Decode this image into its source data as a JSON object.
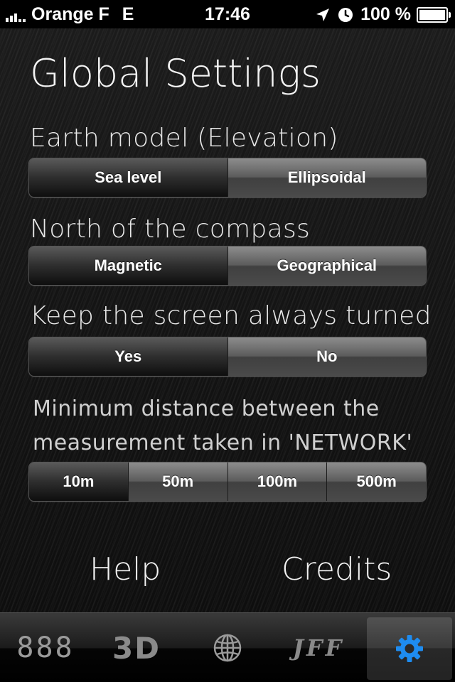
{
  "status_bar": {
    "carrier": "Orange F",
    "network": "E",
    "time": "17:46",
    "battery": "100 %",
    "icons": [
      "signal-bars-icon",
      "location-arrow-icon",
      "alarm-clock-icon",
      "battery-icon"
    ]
  },
  "page": {
    "title": "Global Settings"
  },
  "settings": {
    "earth_model": {
      "label": "Earth model (Elevation)",
      "options": [
        "Sea level",
        "Ellipsoidal"
      ],
      "selected": "Sea level"
    },
    "compass_north": {
      "label": "North of the compass",
      "options": [
        "Magnetic",
        "Geographical"
      ],
      "selected": "Magnetic"
    },
    "keep_screen_on": {
      "label": "Keep the screen always turned on",
      "options": [
        "Yes",
        "No"
      ],
      "selected": "Yes"
    },
    "min_distance": {
      "label_line1": "Minimum distance between the",
      "label_line2": "measurement taken in 'NETWORK'",
      "options": [
        "10m",
        "50m",
        "100m",
        "500m"
      ],
      "selected": "10m"
    }
  },
  "links": {
    "help": "Help",
    "credits": "Credits"
  },
  "tab_bar": {
    "tabs": [
      {
        "name": "digits",
        "label": "888",
        "icon": "digital-display-icon"
      },
      {
        "name": "3d",
        "label": "3D",
        "icon": "3d-text-icon"
      },
      {
        "name": "globe",
        "label": "",
        "icon": "globe-icon"
      },
      {
        "name": "jff",
        "label": "JFF",
        "icon": "jff-text-icon"
      },
      {
        "name": "settings",
        "label": "",
        "icon": "gear-icon"
      }
    ],
    "active": "settings",
    "active_color": "#1e8cf0"
  }
}
